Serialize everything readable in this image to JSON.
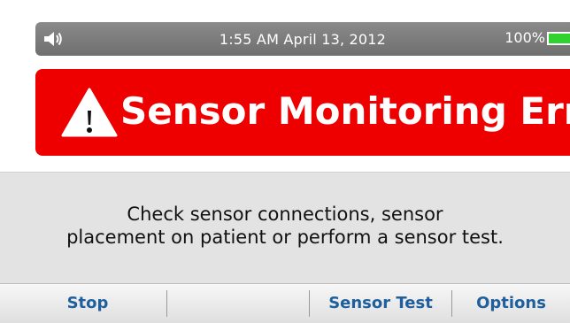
{
  "status_bar": {
    "datetime": "1:55 AM  April 13, 2012",
    "battery_percent": "100%",
    "icons": [
      "speaker-icon",
      "battery-icon"
    ]
  },
  "alarm": {
    "title": "Sensor Monitoring Error",
    "icon": "warning-icon",
    "colors": {
      "background": "#ee0000",
      "text": "#ffffff"
    }
  },
  "message": {
    "line1": "Check sensor connections, sensor",
    "line2": "placement on patient or perform a sensor test."
  },
  "softkeys": {
    "stop": "Stop",
    "blank": "",
    "sensor_test": "Sensor Test",
    "options": "Options",
    "color": "#1f5f9d"
  }
}
